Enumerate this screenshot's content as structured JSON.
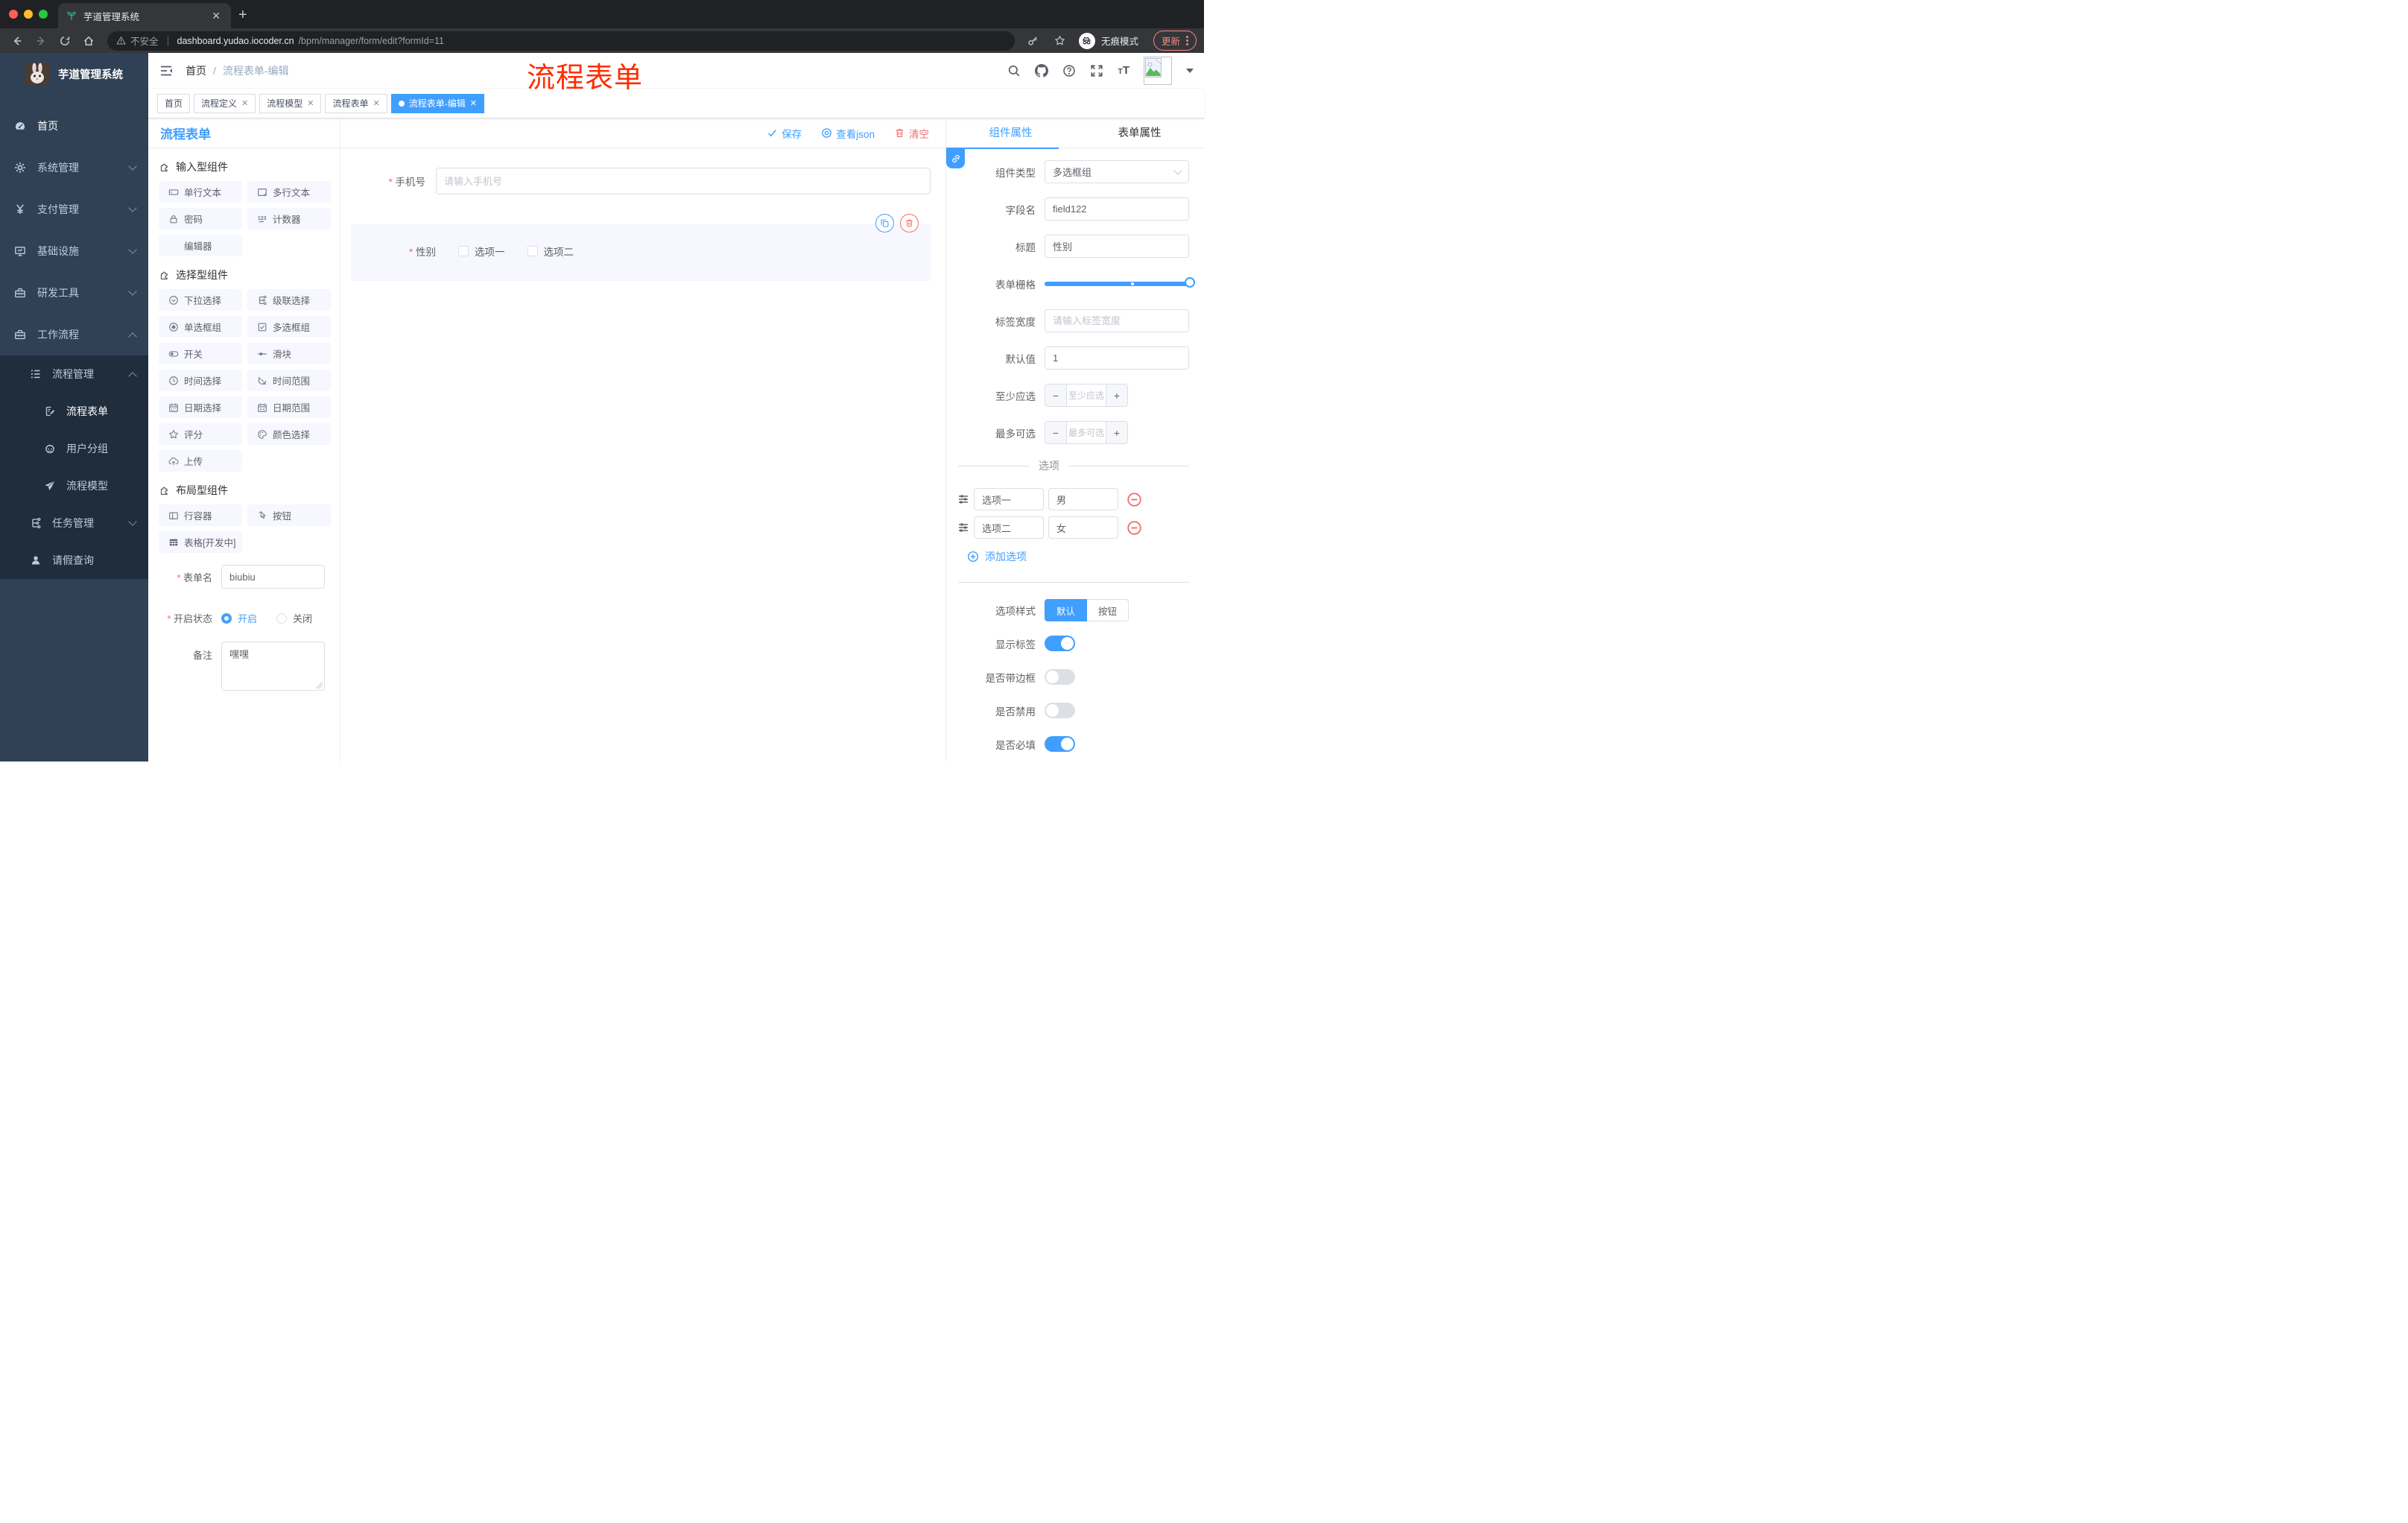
{
  "browser": {
    "tab_title": "芋道管理系统",
    "security_label": "不安全",
    "url_domain": "dashboard.yudao.iocoder.cn",
    "url_path": "/bpm/manager/form/edit?formId=11",
    "incognito_label": "无痕模式",
    "update_label": "更新"
  },
  "annotation": {
    "text": "流程表单",
    "color": "#fe2c00"
  },
  "sidebar": {
    "brand": "芋道管理系统",
    "home": "首页",
    "system": "系统管理",
    "pay": "支付管理",
    "infra": "基础设施",
    "devtool": "研发工具",
    "workflow": "工作流程",
    "process_mgmt": "流程管理",
    "process_form": "流程表单",
    "user_group": "用户分组",
    "process_model": "流程模型",
    "task_mgmt": "任务管理",
    "leave_query": "请假查询"
  },
  "header": {
    "breadcrumb_home": "首页",
    "breadcrumb_current": "流程表单-编辑"
  },
  "tags": {
    "t0": "首页",
    "t1": "流程定义",
    "t2": "流程模型",
    "t3": "流程表单",
    "t4": "流程表单-编辑"
  },
  "page": {
    "title": "流程表单"
  },
  "toolbar": {
    "save": "保存",
    "view_json": "查看json",
    "clear": "清空"
  },
  "components": {
    "group_input": "输入型组件",
    "group_select": "选择型组件",
    "group_layout": "布局型组件",
    "c_single": "单行文本",
    "c_multi": "多行文本",
    "c_password": "密码",
    "c_counter": "计数器",
    "c_editor": "编辑器",
    "c_select": "下拉选择",
    "c_cascade": "级联选择",
    "c_radio": "单选框组",
    "c_checkbox": "多选框组",
    "c_switch": "开关",
    "c_slider": "滑块",
    "c_time": "时间选择",
    "c_timerange": "时间范围",
    "c_date": "日期选择",
    "c_daterange": "日期范围",
    "c_rate": "评分",
    "c_color": "颜色选择",
    "c_upload": "上传",
    "c_row": "行容器",
    "c_button": "按钮",
    "c_table": "表格[开发中]"
  },
  "meta": {
    "form_name_label": "表单名",
    "form_name_value": "biubiu",
    "status_label": "开启状态",
    "status_on": "开启",
    "status_off": "关闭",
    "remark_label": "备注",
    "remark_value": "嘿嘿"
  },
  "canvas": {
    "phone_label": "手机号",
    "phone_placeholder": "请输入手机号",
    "gender_label": "性别",
    "opt1": "选项一",
    "opt2": "选项二"
  },
  "props": {
    "tab_component": "组件属性",
    "tab_form": "表单属性",
    "type_label": "组件类型",
    "type_value": "多选框组",
    "field_label": "字段名",
    "field_value": "field122",
    "title_label": "标题",
    "title_value": "性别",
    "grid_label": "表单栅格",
    "labelw_label": "标签宽度",
    "labelw_placeholder": "请输入标签宽度",
    "default_label": "默认值",
    "default_value": "1",
    "min_label": "至少应选",
    "min_placeholder": "至少应选",
    "max_label": "最多可选",
    "max_placeholder": "最多可选",
    "options_title": "选项",
    "opt1_label": "选项一",
    "opt1_value": "男",
    "opt2_label": "选项二",
    "opt2_value": "女",
    "add_option": "添加选项",
    "style_label": "选项样式",
    "style_default": "默认",
    "style_button": "按钮",
    "show_label": "显示标签",
    "bordered": "是否带边框",
    "disabled": "是否禁用",
    "required": "是否必填"
  },
  "colors": {
    "accent": "#409eff",
    "danger": "#f56c6c",
    "sidebar": "#304156",
    "submenu": "#1f2d3d"
  }
}
